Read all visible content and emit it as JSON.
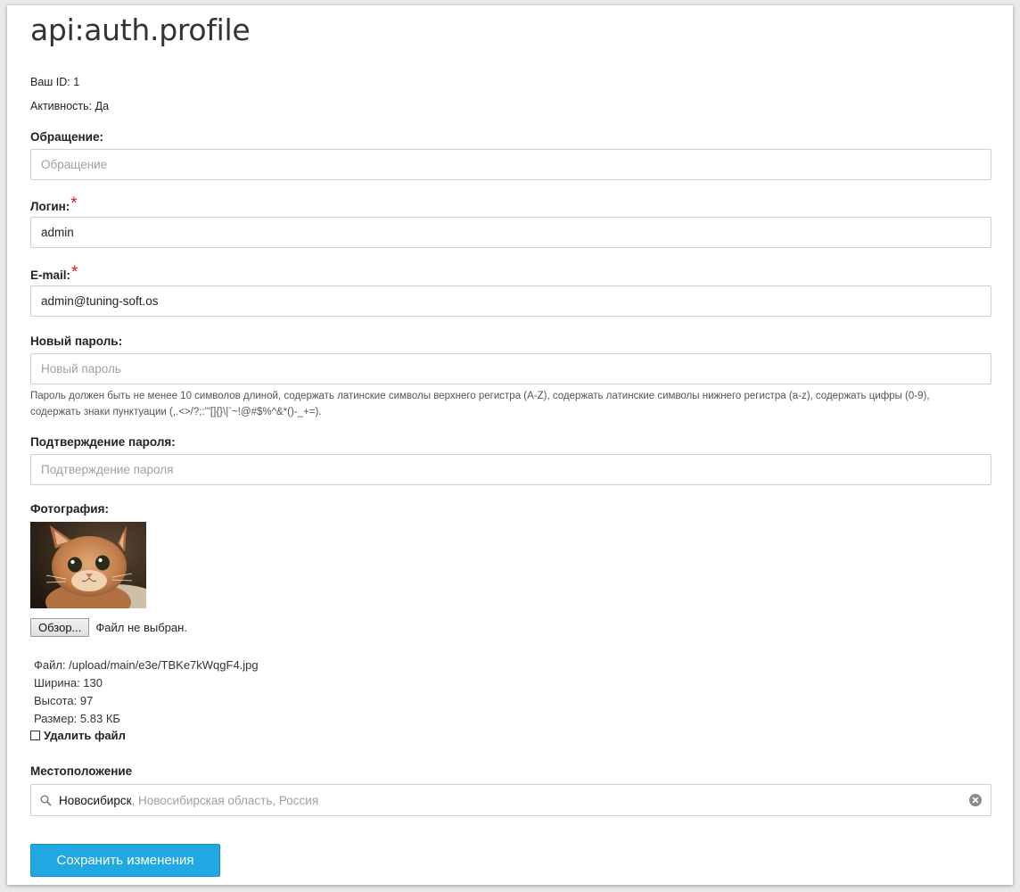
{
  "page": {
    "title": "api:auth.profile"
  },
  "info": {
    "id_label": "Ваш ID:",
    "id_value": "1",
    "active_label": "Активность:",
    "active_value": "Да"
  },
  "form": {
    "salutation": {
      "label": "Обращение:",
      "placeholder": "Обращение",
      "value": ""
    },
    "login": {
      "label": "Логин:",
      "required_mark": "*",
      "placeholder": "",
      "value": "admin"
    },
    "email": {
      "label": "E-mail:",
      "required_mark": "*",
      "placeholder": "",
      "value": "admin@tuning-soft.os"
    },
    "new_password": {
      "label": "Новый пароль:",
      "placeholder": "Новый пароль",
      "value": "",
      "hint_line1": "Пароль должен быть не менее 10 символов длиной, содержать латинские символы верхнего регистра (A-Z), содержать латинские символы нижнего регистра (a-z), содержать цифры (0-9),",
      "hint_line2": "содержать знаки пунктуации (,.<>/?;:'\"[]{}\\|`~!@#$%^&*()-_+=)."
    },
    "confirm_password": {
      "label": "Подтверждение пароля:",
      "placeholder": "Подтверждение пароля",
      "value": ""
    },
    "photo": {
      "label": "Фотография:",
      "browse_label": "Обзор...",
      "no_file_text": "Файл не выбран.",
      "file_line": "Файл: /upload/main/e3e/TBKe7kWqgF4.jpg",
      "width_line": "Ширина: 130",
      "height_line": "Высота: 97",
      "size_line": "Размер: 5.83 КБ",
      "delete_label": "Удалить файл",
      "delete_checked": false
    },
    "location": {
      "label": "Местоположение",
      "city": "Новосибирск",
      "rest": ", Новосибирская область, Россия"
    },
    "save_label": "Сохранить изменения"
  },
  "colors": {
    "accent": "#1fa8e1",
    "required": "#e0141e"
  }
}
